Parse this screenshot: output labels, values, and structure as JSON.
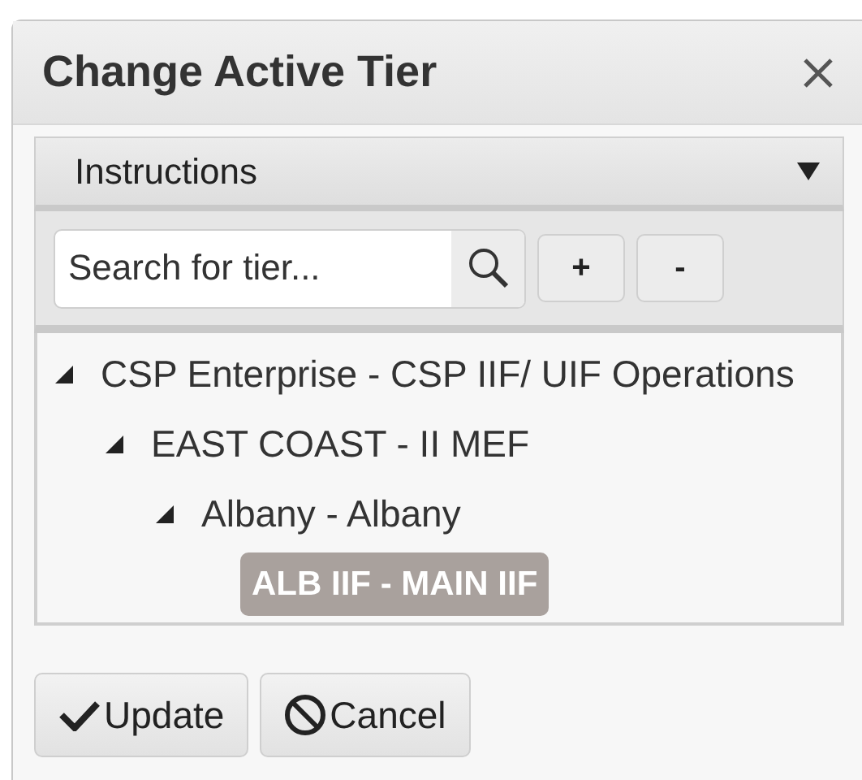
{
  "dialog": {
    "title": "Change Active Tier"
  },
  "instructions": {
    "label": "Instructions",
    "expanded": false
  },
  "search": {
    "placeholder": "Search for tier..."
  },
  "tree_buttons": [
    "+",
    "-"
  ],
  "tree": [
    {
      "label": "CSP Enterprise - CSP IIF/ UIF Operations",
      "expanded": true,
      "selected": false,
      "children": [
        {
          "label": "EAST COAST - II MEF",
          "expanded": true,
          "selected": false,
          "children": [
            {
              "label": "Albany - Albany",
              "expanded": true,
              "selected": false,
              "children": [
                {
                  "label": "ALB IIF - MAIN IIF",
                  "selected": true
                }
              ]
            }
          ]
        }
      ]
    }
  ],
  "buttons": [
    {
      "kind": "update",
      "label": "Update"
    },
    {
      "kind": "cancel",
      "label": "Cancel"
    }
  ]
}
